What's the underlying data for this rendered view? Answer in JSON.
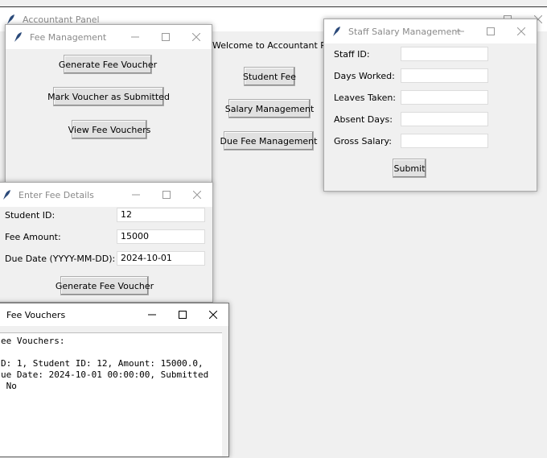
{
  "main": {
    "title": "Accountant Panel",
    "welcome": "Welcome to Accountant Panel",
    "buttons": {
      "student_fee": "Student Fee",
      "salary_management": "Salary Management",
      "due_fee_management": "Due Fee Management"
    }
  },
  "fee_management": {
    "title": "Fee Management",
    "buttons": {
      "generate": "Generate Fee Voucher",
      "mark_submitted": "Mark Voucher as Submitted",
      "view": "View Fee Vouchers"
    }
  },
  "staff_salary": {
    "title": "Staff Salary Management",
    "fields": [
      {
        "label": "Staff ID:",
        "value": ""
      },
      {
        "label": "Days Worked:",
        "value": ""
      },
      {
        "label": "Leaves Taken:",
        "value": ""
      },
      {
        "label": "Absent Days:",
        "value": ""
      },
      {
        "label": "Gross Salary:",
        "value": ""
      }
    ],
    "submit": "Submit"
  },
  "enter_fee": {
    "title": "Enter Fee Details",
    "fields": [
      {
        "label": "Student ID:",
        "value": "12"
      },
      {
        "label": "Fee Amount:",
        "value": "15000"
      },
      {
        "label": "Due Date (YYYY-MM-DD):",
        "value": "2024-10-01"
      }
    ],
    "generate": "Generate Fee Voucher"
  },
  "fee_vouchers": {
    "title": "Fee Vouchers",
    "lines": [
      "ee Vouchers:",
      "",
      "D: 1, Student ID: 12, Amount: 15000.0,",
      "ue Date: 2024-10-01 00:00:00, Submitted",
      " No"
    ]
  },
  "icons": {
    "app": "feather-icon",
    "minimize": "minimize-icon",
    "maximize": "maximize-icon",
    "close": "close-icon"
  }
}
